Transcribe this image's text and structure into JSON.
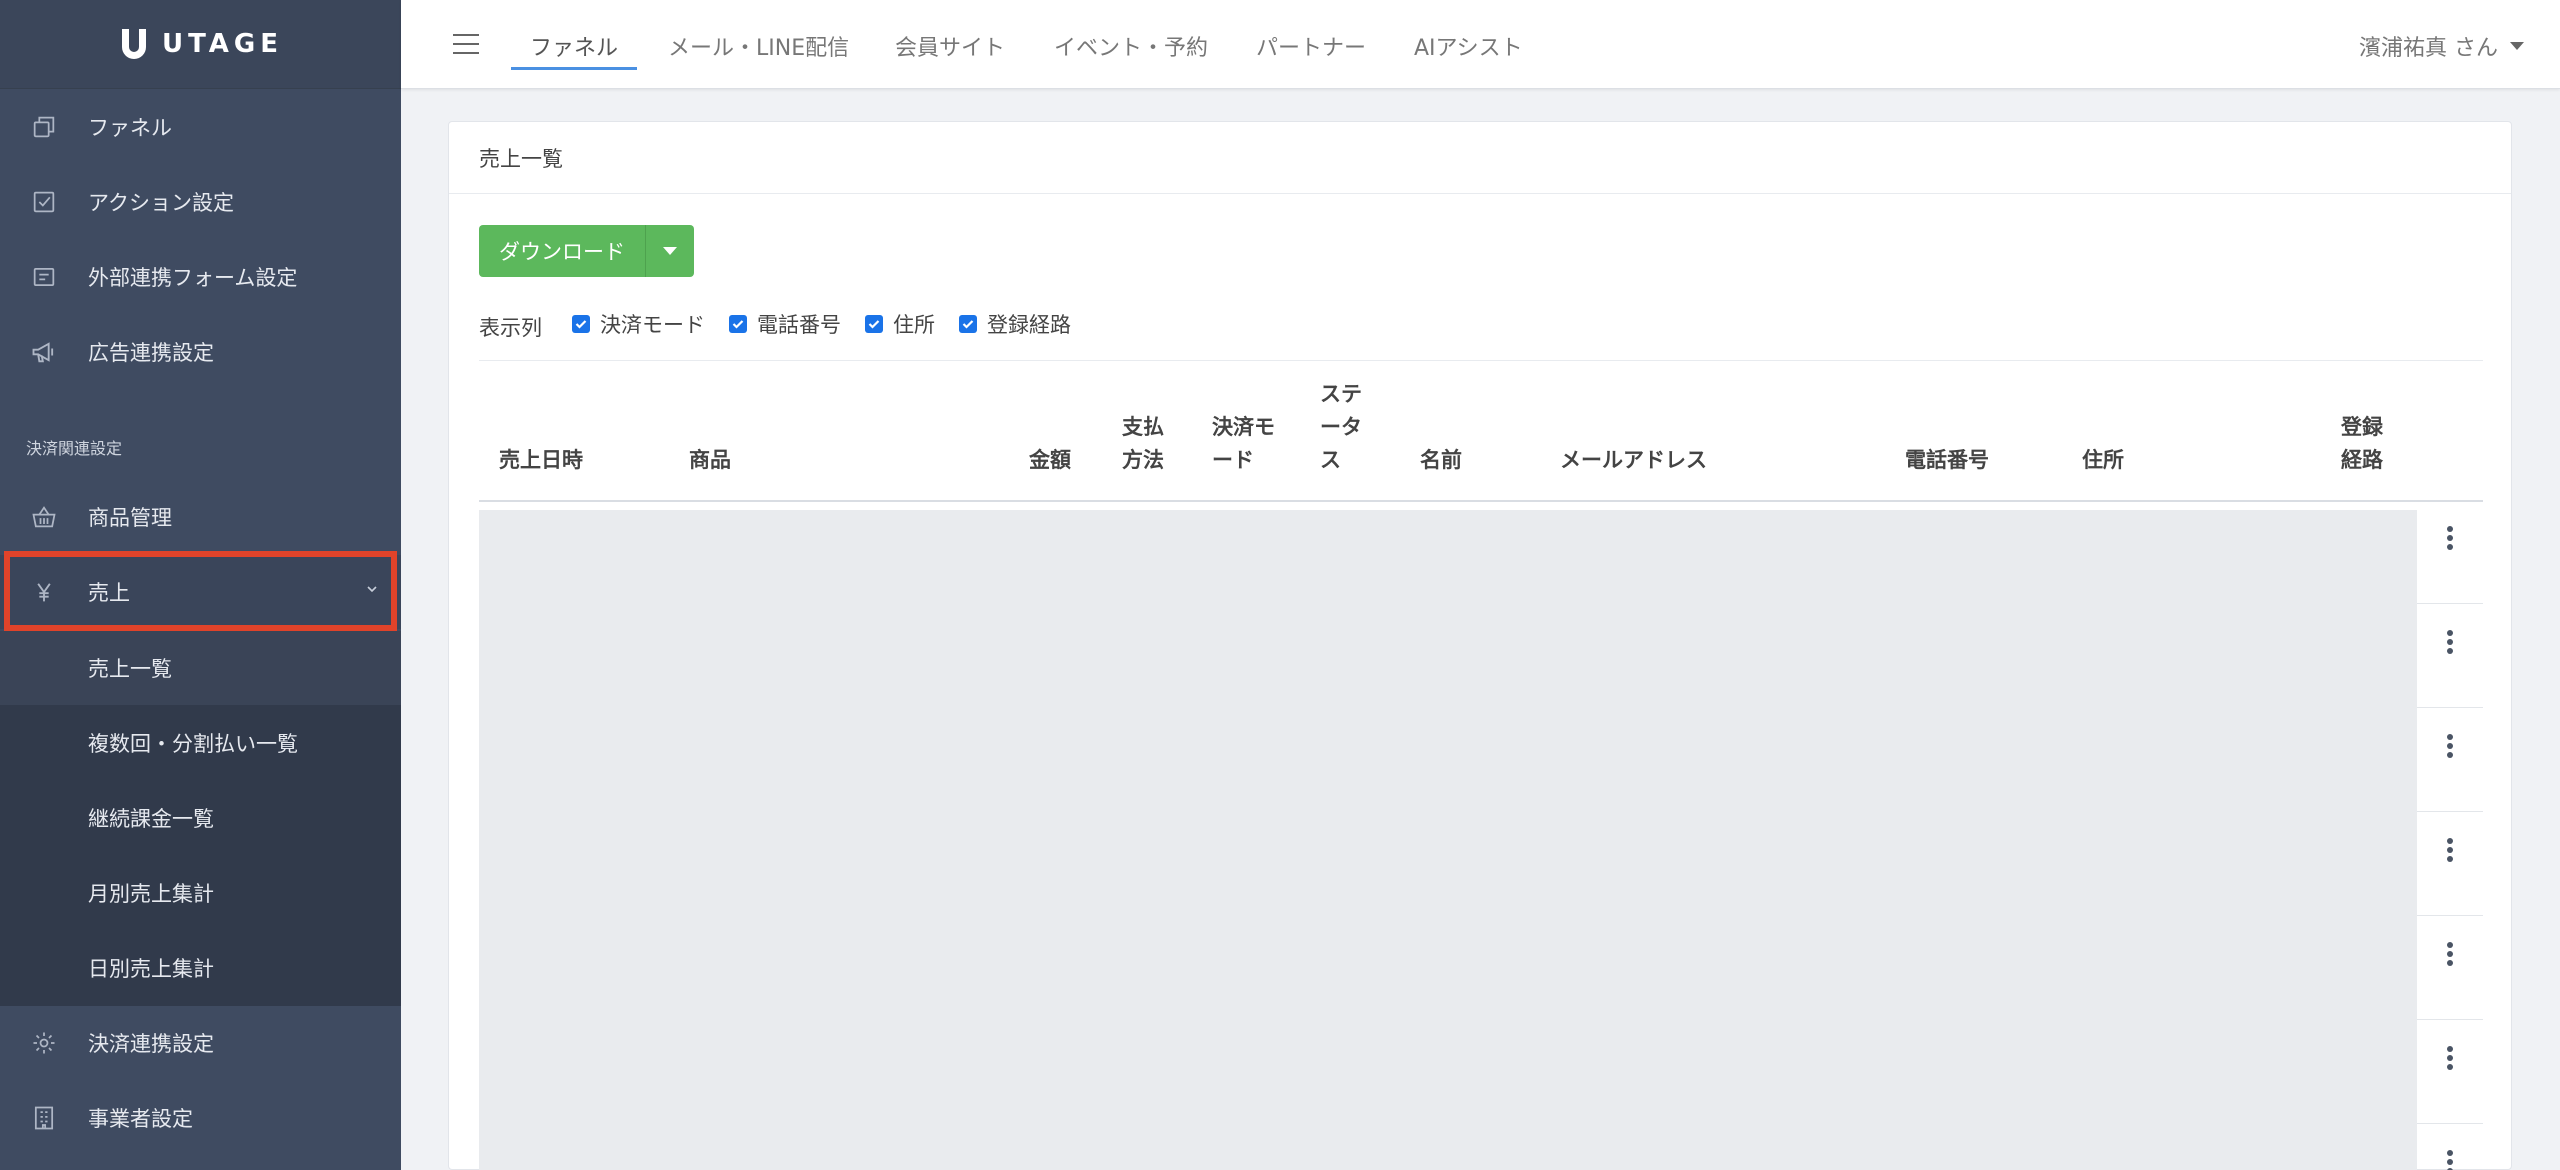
{
  "app": {
    "logo_text": "UTAGE"
  },
  "sidebar": {
    "items": [
      {
        "label": "ファネル",
        "icon": "copy-icon"
      },
      {
        "label": "アクション設定",
        "icon": "check-square-icon"
      },
      {
        "label": "外部連携フォーム設定",
        "icon": "form-icon"
      },
      {
        "label": "広告連携設定",
        "icon": "megaphone-icon"
      }
    ],
    "section_label": "決済関連設定",
    "payment_items": [
      {
        "label": "商品管理",
        "icon": "basket-icon"
      },
      {
        "label": "売上",
        "icon": "yen-icon"
      }
    ],
    "sales_submenu": [
      {
        "label": "売上一覧"
      },
      {
        "label": "複数回・分割払い一覧"
      },
      {
        "label": "継続課金一覧"
      },
      {
        "label": "月別売上集計"
      },
      {
        "label": "日別売上集計"
      }
    ],
    "bottom_items": [
      {
        "label": "決済連携設定",
        "icon": "gear-icon"
      },
      {
        "label": "事業者設定",
        "icon": "building-icon"
      }
    ]
  },
  "topbar": {
    "tabs": [
      {
        "label": "ファネル"
      },
      {
        "label": "メール・LINE配信"
      },
      {
        "label": "会員サイト"
      },
      {
        "label": "イベント・予約"
      },
      {
        "label": "パートナー"
      },
      {
        "label": "AIアシスト"
      }
    ],
    "user_name": "濱浦祐真 さん"
  },
  "page": {
    "title": "売上一覧",
    "download_label": "ダウンロード",
    "columns_label": "表示列",
    "column_toggles": [
      {
        "label": "決済モード",
        "checked": true
      },
      {
        "label": "電話番号",
        "checked": true
      },
      {
        "label": "住所",
        "checked": true
      },
      {
        "label": "登録経路",
        "checked": true
      }
    ]
  },
  "table": {
    "headers": [
      {
        "lines": [
          "売上日時"
        ]
      },
      {
        "lines": [
          "商品"
        ]
      },
      {
        "lines": [
          "金額"
        ]
      },
      {
        "lines": [
          "支払",
          "方法"
        ]
      },
      {
        "lines": [
          "決済モ",
          "ード"
        ]
      },
      {
        "lines": [
          "ステ",
          "ータ",
          "ス"
        ]
      },
      {
        "lines": [
          "名前"
        ]
      },
      {
        "lines": [
          "メールアドレス"
        ]
      },
      {
        "lines": [
          "電話番号"
        ]
      },
      {
        "lines": [
          "住所"
        ]
      },
      {
        "lines": [
          "登録",
          "経路"
        ]
      }
    ]
  },
  "colors": {
    "sidebar_bg": "#3f4b61",
    "submenu_bg": "#313a4b",
    "accent_blue": "#4a90e2",
    "button_green": "#5cb85c",
    "highlight_red": "#e0432a"
  }
}
